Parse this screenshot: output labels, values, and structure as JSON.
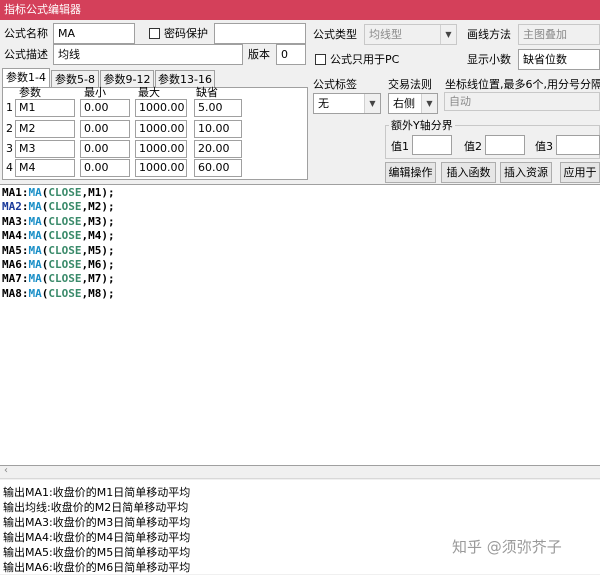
{
  "window": {
    "title": "指标公式编辑器"
  },
  "form": {
    "name_label": "公式名称",
    "name_value": "MA",
    "password_label": "密码保护",
    "desc_label": "公式描述",
    "desc_value": "均线",
    "version_label": "版本",
    "version_value": "0",
    "type_label": "公式类型",
    "type_value": "均线型",
    "draw_label": "画线方法",
    "draw_value": "主图叠加",
    "pc_only_label": "公式只用于PC",
    "decimals_label": "显示小数",
    "decimals_value": "缺省位数"
  },
  "tabs": [
    "参数1-4",
    "参数5-8",
    "参数9-12",
    "参数13-16"
  ],
  "params": {
    "headers": [
      "参数",
      "最小",
      "最大",
      "缺省"
    ],
    "rows": [
      {
        "idx": "1",
        "name": "M1",
        "min": "0.00",
        "max": "1000.00",
        "def": "5.00"
      },
      {
        "idx": "2",
        "name": "M2",
        "min": "0.00",
        "max": "1000.00",
        "def": "10.00"
      },
      {
        "idx": "3",
        "name": "M3",
        "min": "0.00",
        "max": "1000.00",
        "def": "20.00"
      },
      {
        "idx": "4",
        "name": "M4",
        "min": "0.00",
        "max": "1000.00",
        "def": "60.00"
      }
    ]
  },
  "right": {
    "tag_label": "公式标签",
    "tag_value": "无",
    "trade_label": "交易法则",
    "trade_value": "右侧",
    "coord_label": "坐标线位置,最多6个,用分号分隔",
    "coord_value": "自动",
    "yaxis_label": "额外Y轴分界",
    "val1_label": "值1",
    "val2_label": "值2",
    "val3_label": "值3"
  },
  "buttons": {
    "edit": "编辑操作",
    "insert_fn": "插入函数",
    "insert_res": "插入资源",
    "apply": "应用于"
  },
  "code": [
    {
      "name": "MA1",
      "fn": "MA",
      "arg": "CLOSE",
      "param": "M1",
      "highlight": false
    },
    {
      "name": "MA2",
      "fn": "MA",
      "arg": "CLOSE",
      "param": "M2",
      "highlight": true
    },
    {
      "name": "MA3",
      "fn": "MA",
      "arg": "CLOSE",
      "param": "M3",
      "highlight": false
    },
    {
      "name": "MA4",
      "fn": "MA",
      "arg": "CLOSE",
      "param": "M4",
      "highlight": false
    },
    {
      "name": "MA5",
      "fn": "MA",
      "arg": "CLOSE",
      "param": "M5",
      "highlight": false
    },
    {
      "name": "MA6",
      "fn": "MA",
      "arg": "CLOSE",
      "param": "M6",
      "highlight": false
    },
    {
      "name": "MA7",
      "fn": "MA",
      "arg": "CLOSE",
      "param": "M7",
      "highlight": false
    },
    {
      "name": "MA8",
      "fn": "MA",
      "arg": "CLOSE",
      "param": "M8",
      "highlight": false
    }
  ],
  "output": [
    "输出MA1:收盘价的M1日简单移动平均",
    "输出均线:收盘价的M2日简单移动平均",
    "输出MA3:收盘价的M3日简单移动平均",
    "输出MA4:收盘价的M4日简单移动平均",
    "输出MA5:收盘价的M5日简单移动平均",
    "输出MA6:收盘价的M6日简单移动平均"
  ],
  "watermark": "知乎 @须弥芥子",
  "colors": {
    "titlebar": "#d4405a",
    "function": "#1a8fc7",
    "keyword": "#3a8a6a",
    "highlight_name": "#1a3a9a"
  }
}
